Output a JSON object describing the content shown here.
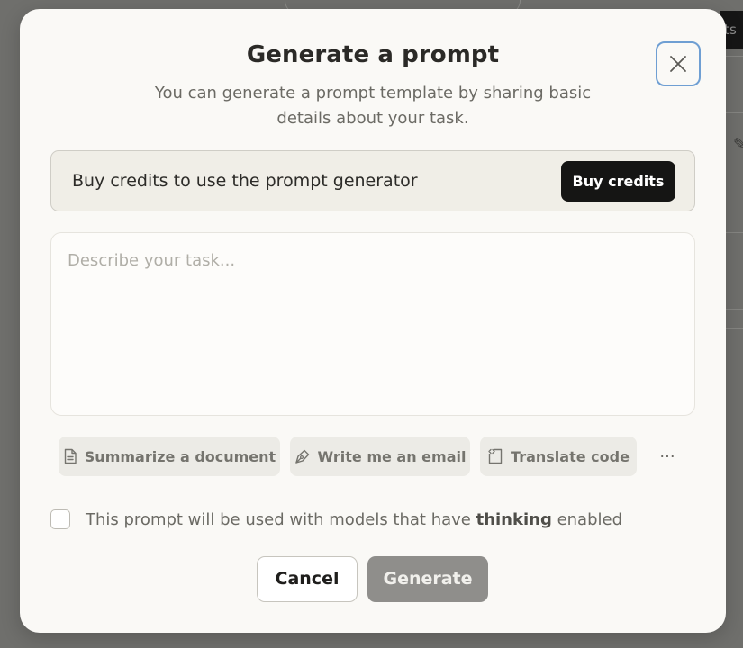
{
  "background": {
    "tab_fragment": "its"
  },
  "modal": {
    "title": "Generate a prompt",
    "subtitle": "You can generate a prompt template by sharing basic details about your task.",
    "close_icon": "close-icon"
  },
  "credits_banner": {
    "text": "Buy credits to use the prompt generator",
    "button_label": "Buy credits"
  },
  "task_input": {
    "placeholder": "Describe your task...",
    "value": ""
  },
  "suggestions": [
    {
      "label": "Summarize a document",
      "icon": "document-icon"
    },
    {
      "label": "Write me an email",
      "icon": "pen-nib-icon"
    },
    {
      "label": "Translate code",
      "icon": "code-file-icon"
    }
  ],
  "more_label": "···",
  "thinking": {
    "checked": false,
    "prefix": "This prompt will be used with models that have ",
    "emphasis": "thinking",
    "suffix": " enabled"
  },
  "footer": {
    "cancel_label": "Cancel",
    "generate_label": "Generate"
  },
  "colors": {
    "overlay": "#6f6f6c",
    "modal_bg": "#faf9f6",
    "primary_dark": "#151514",
    "focus_ring": "#6f9fd3",
    "disabled_button": "#8f8e8b"
  }
}
